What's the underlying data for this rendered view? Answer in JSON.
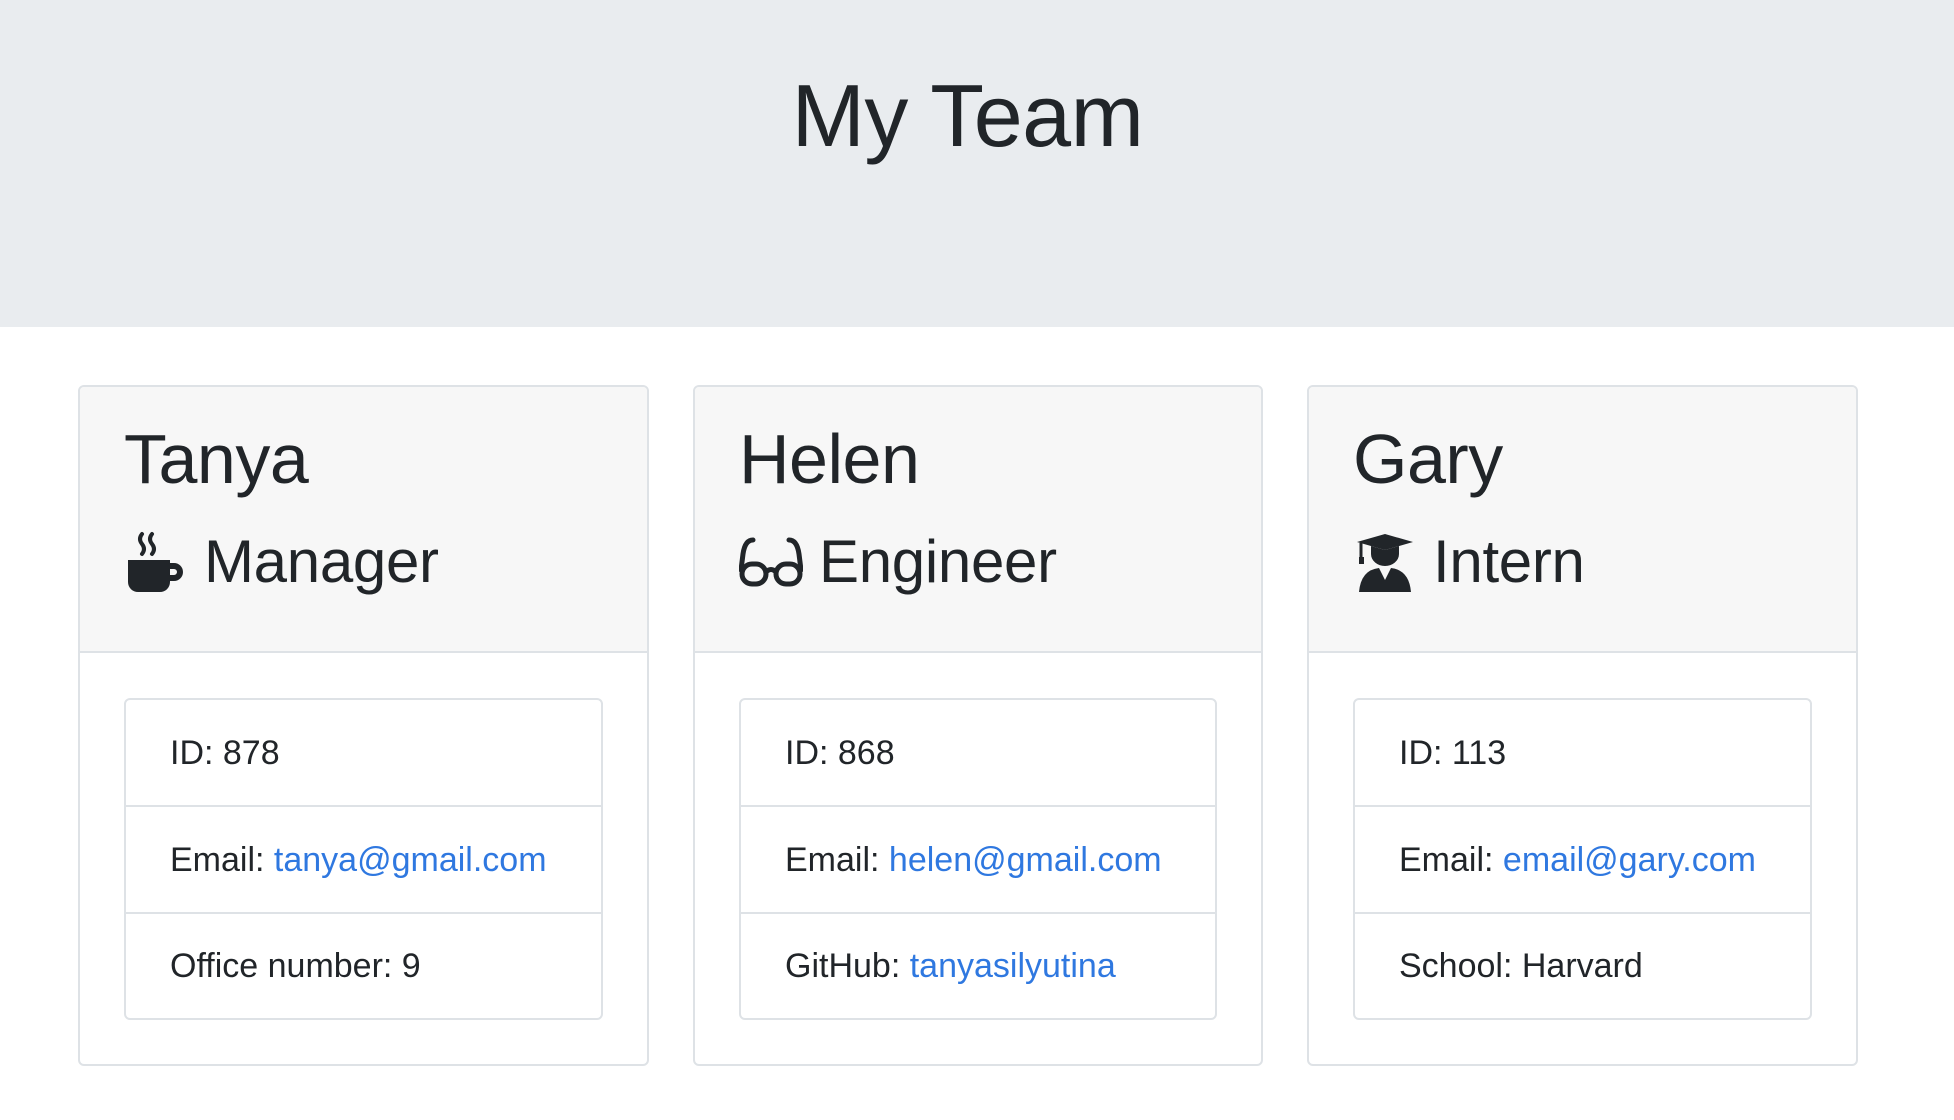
{
  "header": {
    "title": "My Team"
  },
  "team": [
    {
      "name": "Tanya",
      "role": "Manager",
      "role_icon": "coffee-icon",
      "id_label": "ID: 878",
      "email_prefix": "Email: ",
      "email": "tanya@gmail.com",
      "extra_prefix": "Office number: 9",
      "extra_link": ""
    },
    {
      "name": "Helen",
      "role": "Engineer",
      "role_icon": "glasses-icon",
      "id_label": "ID: 868",
      "email_prefix": "Email: ",
      "email": "helen@gmail.com",
      "extra_prefix": "GitHub: ",
      "extra_link": "tanyasilyutina"
    },
    {
      "name": "Gary",
      "role": "Intern",
      "role_icon": "graduate-icon",
      "id_label": "ID: 113",
      "email_prefix": "Email: ",
      "email": "email@gary.com",
      "extra_prefix": "School: Harvard",
      "extra_link": ""
    }
  ],
  "colors": {
    "jumbotron_bg": "#e9ecef",
    "link": "#2f78e0",
    "card_header_bg": "#f7f7f7"
  }
}
